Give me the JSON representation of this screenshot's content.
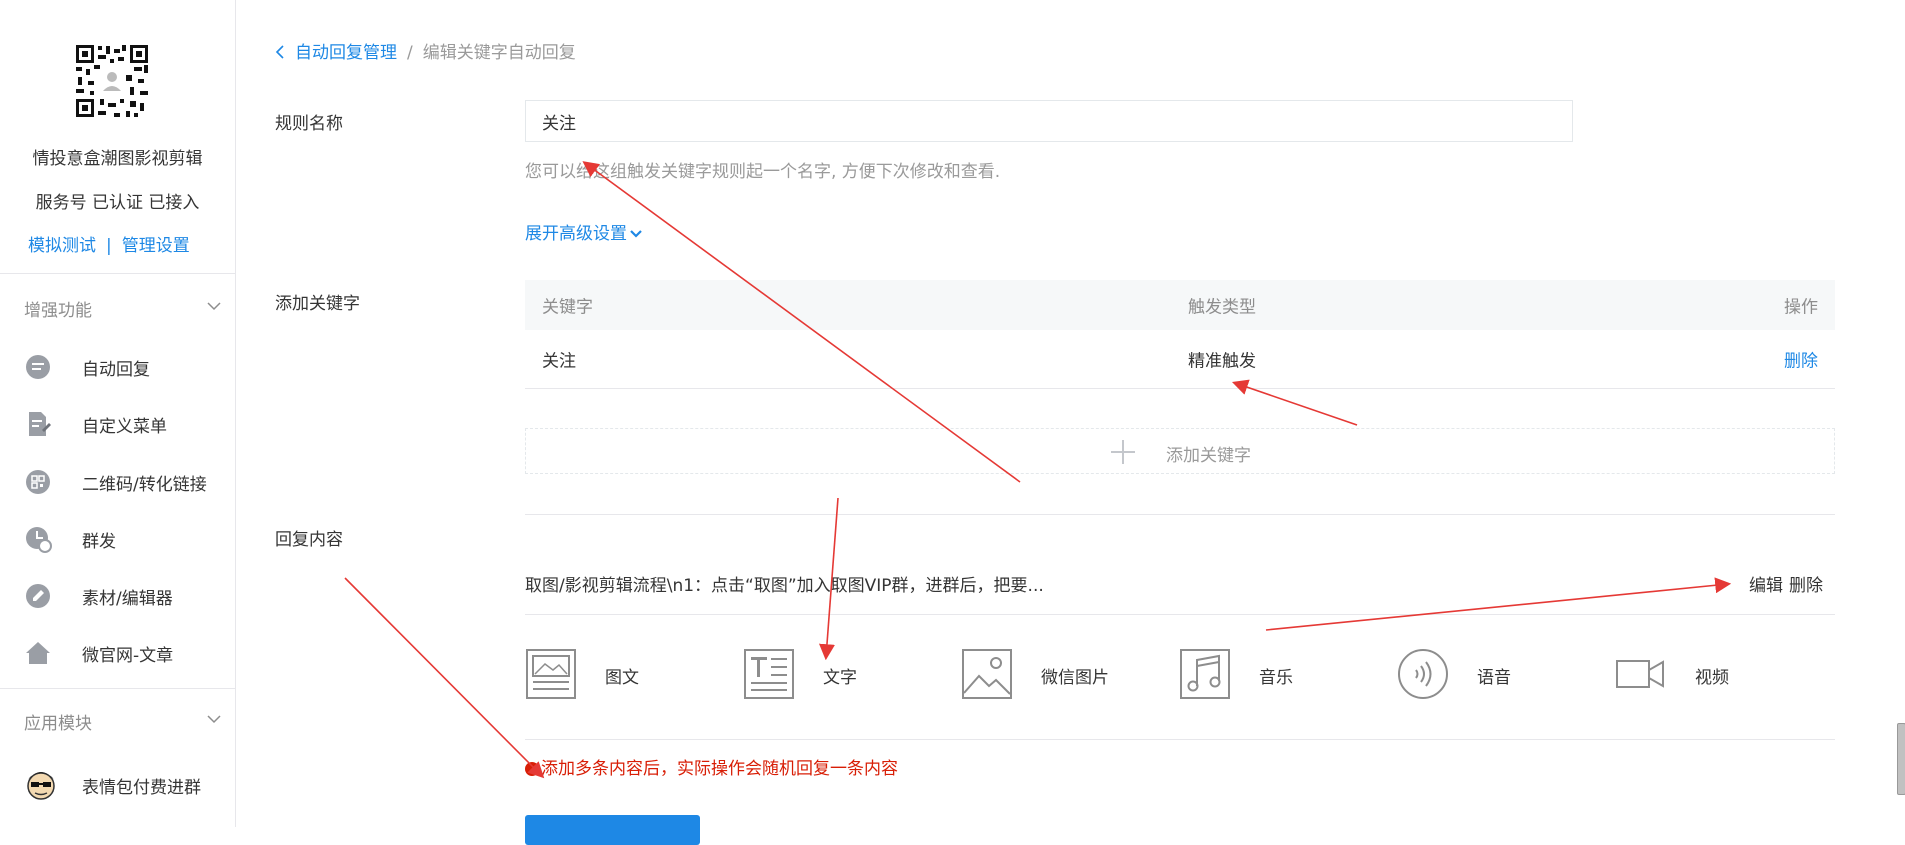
{
  "account": {
    "name": "情投意盒潮图影视剪辑",
    "status": "服务号 已认证 已接入",
    "links": [
      "模拟测试",
      "管理设置"
    ],
    "link_separator": "|"
  },
  "sidebar": {
    "sections": [
      {
        "title": "增强功能",
        "items": [
          {
            "label": "自动回复",
            "icon": "chat-bubble-icon"
          },
          {
            "label": "自定义菜单",
            "icon": "document-edit-icon"
          },
          {
            "label": "二维码/转化链接",
            "icon": "qrcode-link-icon"
          },
          {
            "label": "群发",
            "icon": "clock-send-icon"
          },
          {
            "label": "素材/编辑器",
            "icon": "pencil-icon"
          },
          {
            "label": "微官网-文章",
            "icon": "house-icon"
          }
        ]
      },
      {
        "title": "应用模块",
        "items": [
          {
            "label": "表情包付费进群",
            "icon": "avatar-face-icon"
          }
        ]
      }
    ]
  },
  "breadcrumb": {
    "back_label": "自动回复管理",
    "separator": "/",
    "current": "编辑关键字自动回复"
  },
  "form": {
    "rule_name_label": "规则名称",
    "rule_name_value": "关注",
    "rule_name_hint": "您可以给这组触发关键字规则起一个名字, 方便下次修改和查看.",
    "advanced_toggle": "展开高级设置",
    "keywords_label": "添加关键字",
    "reply_label": "回复内容"
  },
  "keyword_table": {
    "columns": [
      "关键字",
      "触发类型",
      "操作"
    ],
    "rows": [
      {
        "keyword": "关注",
        "trigger": "精准触发",
        "action": "删除"
      }
    ],
    "add_label": "添加关键字"
  },
  "reply": {
    "item_text": "取图/影视剪辑流程\\n1：点击“取图”加入取图VIP群，进群后，把要...",
    "edit_label": "编辑",
    "delete_label": "删除",
    "types": [
      {
        "label": "图文",
        "icon": "news-article-icon"
      },
      {
        "label": "文字",
        "icon": "text-icon"
      },
      {
        "label": "微信图片",
        "icon": "image-icon"
      },
      {
        "label": "音乐",
        "icon": "music-icon"
      },
      {
        "label": "语音",
        "icon": "voice-icon"
      },
      {
        "label": "视频",
        "icon": "video-icon"
      }
    ],
    "warning": "添加多条内容后，实际操作会随机回复一条内容"
  },
  "colors": {
    "accent": "#1e88e5",
    "text": "#353535",
    "muted": "#9a9a9a",
    "warning": "#d81e06",
    "annotation_arrow": "#e53935"
  }
}
